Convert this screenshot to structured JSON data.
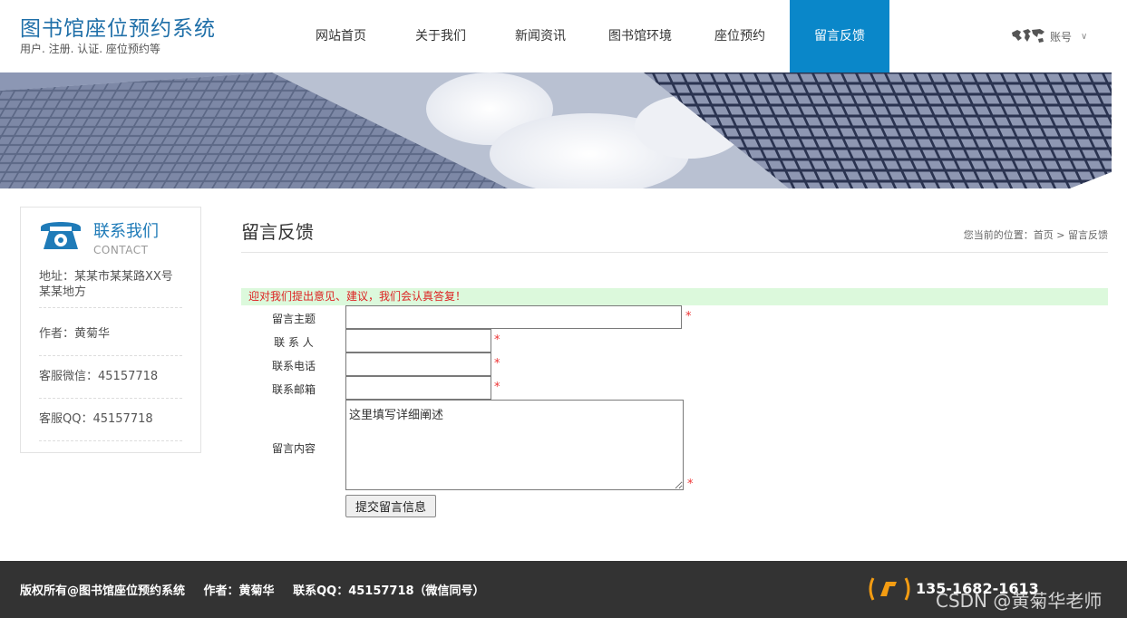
{
  "header": {
    "logo_title": "图书馆座位预约系统",
    "logo_subtitle": "用户. 注册. 认证. 座位预约等",
    "nav": [
      {
        "label": "网站首页"
      },
      {
        "label": "关于我们"
      },
      {
        "label": "新闻资讯"
      },
      {
        "label": "图书馆环境"
      },
      {
        "label": "座位预约"
      },
      {
        "label": "留言反馈",
        "active": true
      }
    ],
    "account_label": "账号",
    "account_chevron": "∨"
  },
  "sidebar": {
    "title": "联系我们",
    "subtitle": "CONTACT",
    "address": "地址：某某市某某路XX号某某地方",
    "author": "作者：黄菊华",
    "wechat": "客服微信：45157718",
    "qq": "客服QQ：45157718"
  },
  "main": {
    "page_title": "留言反馈",
    "breadcrumb": "您当前的位置：首页 > 留言反馈",
    "notice": "迎对我们提出意见、建议，我们会认真答复！",
    "form": {
      "subject_label": "留言主题",
      "contact_label": "联 系 人",
      "phone_label": "联系电话",
      "email_label": "联系邮箱",
      "content_label": "留言内容",
      "content_value": "这里填写详细阐述",
      "required_mark": "*",
      "submit_label": "提交留言信息"
    }
  },
  "footer": {
    "copyright": "版权所有@图书馆座位预约系统",
    "author": "作者：黄菊华",
    "qq": "联系QQ：45157718（微信同号）",
    "phone": "135-1682-1613",
    "watermark": "CSDN @黄菊华老师"
  },
  "colors": {
    "brand_blue": "#0a87c9",
    "notice_bg": "#dcf9dc",
    "notice_text": "#dd2222",
    "footer_bg": "#333333",
    "phone_icon": "#f39c12"
  }
}
